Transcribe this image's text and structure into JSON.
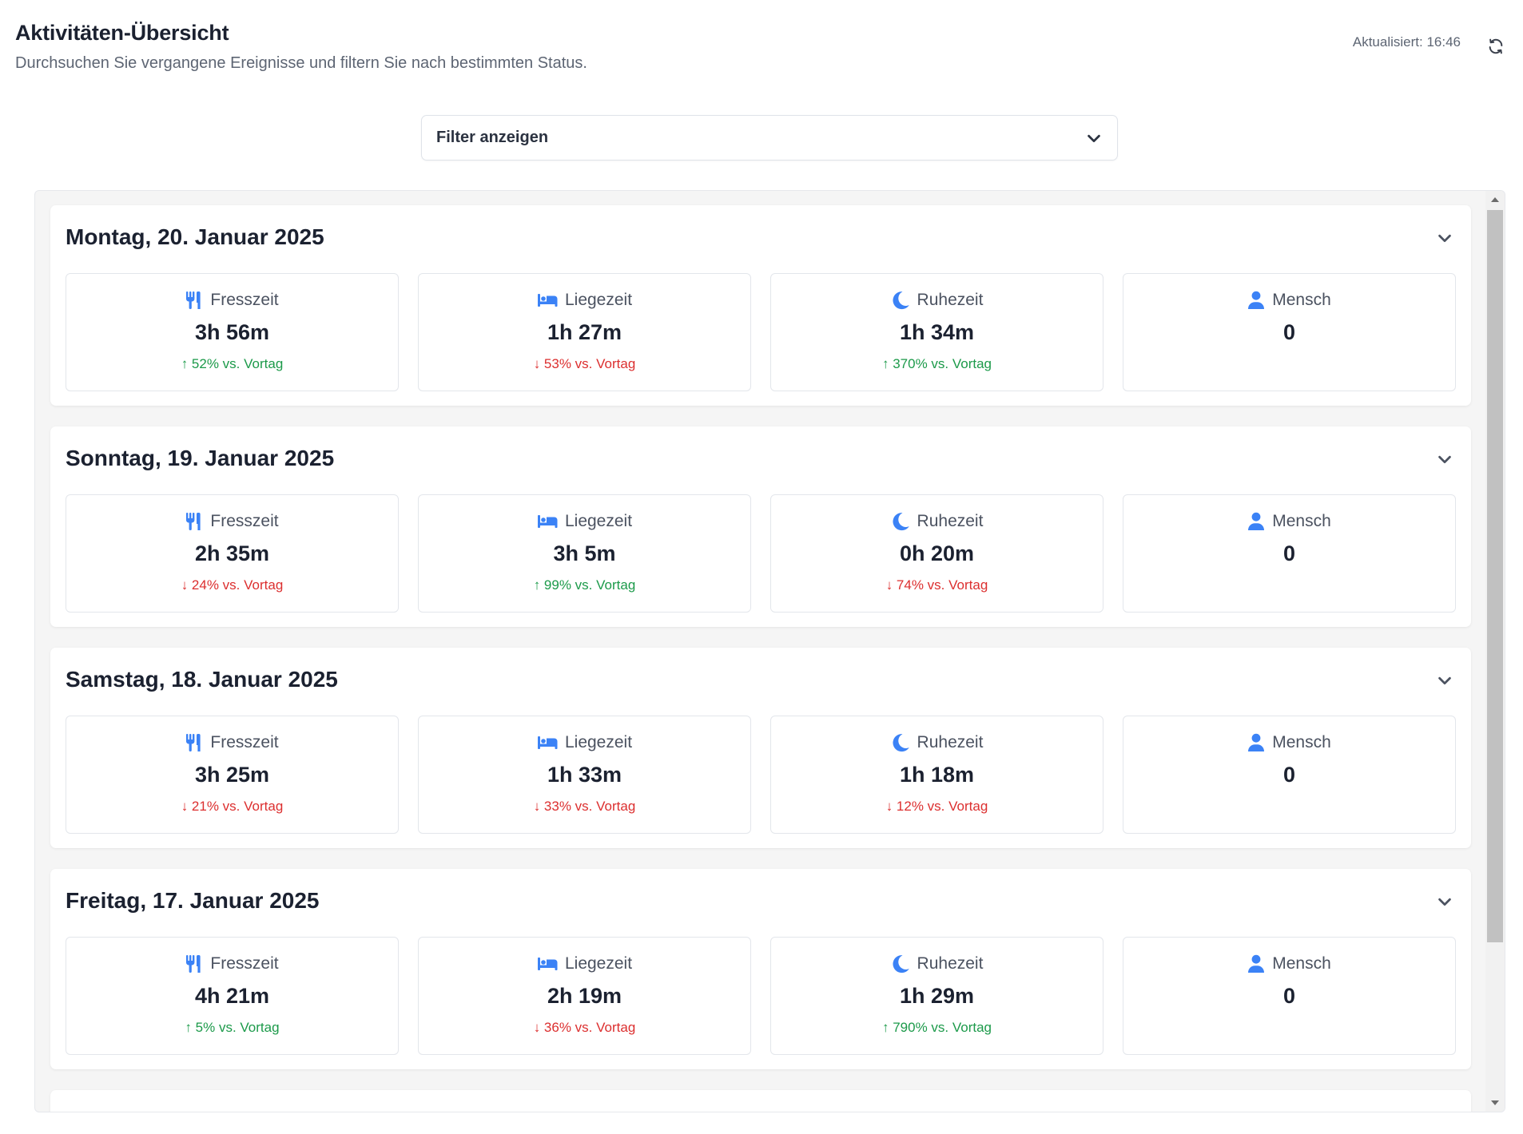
{
  "header": {
    "title": "Aktivitäten-Übersicht",
    "subtitle": "Durchsuchen Sie vergangene Ereignisse und filtern Sie nach bestimmten Status.",
    "updated": "Aktualisiert: 16:46",
    "refresh_icon": "refresh-icon"
  },
  "filter": {
    "label": "Filter anzeigen",
    "icon": "chevron-down-icon"
  },
  "colors": {
    "accent_icon": "#3b82f6",
    "increase": "#1c9a4a",
    "decrease": "#dc2f2f"
  },
  "days": [
    {
      "title": "Montag, 20. Januar 2025",
      "metrics": [
        {
          "icon": "utensils-icon",
          "label": "Fresszeit",
          "value": "3h 56m",
          "change": "↑ 52% vs. Vortag",
          "trend": "up"
        },
        {
          "icon": "bed-icon",
          "label": "Liegezeit",
          "value": "1h 27m",
          "change": "↓ 53% vs. Vortag",
          "trend": "down"
        },
        {
          "icon": "moon-icon",
          "label": "Ruhezeit",
          "value": "1h 34m",
          "change": "↑ 370% vs. Vortag",
          "trend": "up"
        },
        {
          "icon": "user-icon",
          "label": "Mensch",
          "value": "0",
          "change": "",
          "trend": ""
        }
      ]
    },
    {
      "title": "Sonntag, 19. Januar 2025",
      "metrics": [
        {
          "icon": "utensils-icon",
          "label": "Fresszeit",
          "value": "2h 35m",
          "change": "↓ 24% vs. Vortag",
          "trend": "down"
        },
        {
          "icon": "bed-icon",
          "label": "Liegezeit",
          "value": "3h 5m",
          "change": "↑ 99% vs. Vortag",
          "trend": "up"
        },
        {
          "icon": "moon-icon",
          "label": "Ruhezeit",
          "value": "0h 20m",
          "change": "↓ 74% vs. Vortag",
          "trend": "down"
        },
        {
          "icon": "user-icon",
          "label": "Mensch",
          "value": "0",
          "change": "",
          "trend": ""
        }
      ]
    },
    {
      "title": "Samstag, 18. Januar 2025",
      "metrics": [
        {
          "icon": "utensils-icon",
          "label": "Fresszeit",
          "value": "3h 25m",
          "change": "↓ 21% vs. Vortag",
          "trend": "down"
        },
        {
          "icon": "bed-icon",
          "label": "Liegezeit",
          "value": "1h 33m",
          "change": "↓ 33% vs. Vortag",
          "trend": "down"
        },
        {
          "icon": "moon-icon",
          "label": "Ruhezeit",
          "value": "1h 18m",
          "change": "↓ 12% vs. Vortag",
          "trend": "down"
        },
        {
          "icon": "user-icon",
          "label": "Mensch",
          "value": "0",
          "change": "",
          "trend": ""
        }
      ]
    },
    {
      "title": "Freitag, 17. Januar 2025",
      "metrics": [
        {
          "icon": "utensils-icon",
          "label": "Fresszeit",
          "value": "4h 21m",
          "change": "↑ 5% vs. Vortag",
          "trend": "up"
        },
        {
          "icon": "bed-icon",
          "label": "Liegezeit",
          "value": "2h 19m",
          "change": "↓ 36% vs. Vortag",
          "trend": "down"
        },
        {
          "icon": "moon-icon",
          "label": "Ruhezeit",
          "value": "1h 29m",
          "change": "↑ 790% vs. Vortag",
          "trend": "up"
        },
        {
          "icon": "user-icon",
          "label": "Mensch",
          "value": "0",
          "change": "",
          "trend": ""
        }
      ]
    }
  ]
}
